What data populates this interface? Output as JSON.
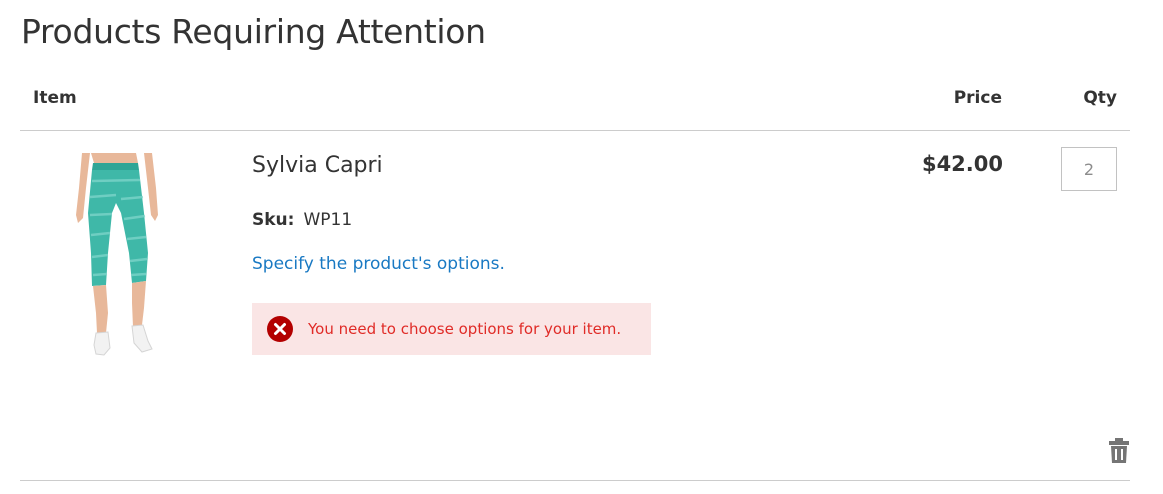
{
  "page": {
    "title": "Products Requiring Attention"
  },
  "table": {
    "headers": {
      "item": "Item",
      "price": "Price",
      "qty": "Qty"
    }
  },
  "item": {
    "name": "Sylvia Capri",
    "sku_label": "Sku:",
    "sku_value": "WP11",
    "options_link": "Specify the product's options.",
    "error_message": "You need to choose options for your item.",
    "price": "$42.00",
    "qty": "2"
  },
  "icons": {
    "error": "error-x-icon",
    "delete": "trash-icon"
  },
  "colors": {
    "link": "#1979c3",
    "error_text": "#e02b27",
    "error_bg": "#fae5e5",
    "error_icon": "#b30000",
    "product": "#3fb8a8"
  }
}
